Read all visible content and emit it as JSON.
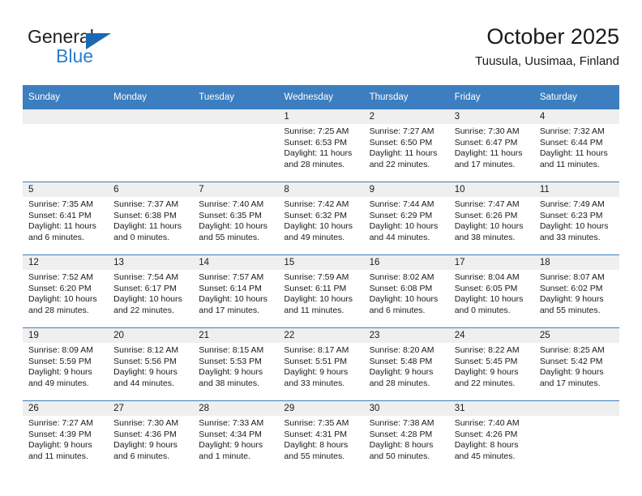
{
  "logo": {
    "word_top": "General",
    "word_bottom": "Blue",
    "triangle_color": "#1b68b3",
    "blue_color": "#2a7fc9"
  },
  "header": {
    "title": "October 2025",
    "location": "Tuusula, Uusimaa, Finland"
  },
  "theme": {
    "header_blue": "#3c7ebf",
    "daynum_band": "#efefef",
    "text": "#1a1a1a"
  },
  "calendar": {
    "weekdays": [
      "Sunday",
      "Monday",
      "Tuesday",
      "Wednesday",
      "Thursday",
      "Friday",
      "Saturday"
    ],
    "weeks": [
      [
        {
          "empty": true
        },
        {
          "empty": true
        },
        {
          "empty": true
        },
        {
          "day": "1",
          "sunrise": "Sunrise: 7:25 AM",
          "sunset": "Sunset: 6:53 PM",
          "daylight1": "Daylight: 11 hours",
          "daylight2": "and 28 minutes."
        },
        {
          "day": "2",
          "sunrise": "Sunrise: 7:27 AM",
          "sunset": "Sunset: 6:50 PM",
          "daylight1": "Daylight: 11 hours",
          "daylight2": "and 22 minutes."
        },
        {
          "day": "3",
          "sunrise": "Sunrise: 7:30 AM",
          "sunset": "Sunset: 6:47 PM",
          "daylight1": "Daylight: 11 hours",
          "daylight2": "and 17 minutes."
        },
        {
          "day": "4",
          "sunrise": "Sunrise: 7:32 AM",
          "sunset": "Sunset: 6:44 PM",
          "daylight1": "Daylight: 11 hours",
          "daylight2": "and 11 minutes."
        }
      ],
      [
        {
          "day": "5",
          "sunrise": "Sunrise: 7:35 AM",
          "sunset": "Sunset: 6:41 PM",
          "daylight1": "Daylight: 11 hours",
          "daylight2": "and 6 minutes."
        },
        {
          "day": "6",
          "sunrise": "Sunrise: 7:37 AM",
          "sunset": "Sunset: 6:38 PM",
          "daylight1": "Daylight: 11 hours",
          "daylight2": "and 0 minutes."
        },
        {
          "day": "7",
          "sunrise": "Sunrise: 7:40 AM",
          "sunset": "Sunset: 6:35 PM",
          "daylight1": "Daylight: 10 hours",
          "daylight2": "and 55 minutes."
        },
        {
          "day": "8",
          "sunrise": "Sunrise: 7:42 AM",
          "sunset": "Sunset: 6:32 PM",
          "daylight1": "Daylight: 10 hours",
          "daylight2": "and 49 minutes."
        },
        {
          "day": "9",
          "sunrise": "Sunrise: 7:44 AM",
          "sunset": "Sunset: 6:29 PM",
          "daylight1": "Daylight: 10 hours",
          "daylight2": "and 44 minutes."
        },
        {
          "day": "10",
          "sunrise": "Sunrise: 7:47 AM",
          "sunset": "Sunset: 6:26 PM",
          "daylight1": "Daylight: 10 hours",
          "daylight2": "and 38 minutes."
        },
        {
          "day": "11",
          "sunrise": "Sunrise: 7:49 AM",
          "sunset": "Sunset: 6:23 PM",
          "daylight1": "Daylight: 10 hours",
          "daylight2": "and 33 minutes."
        }
      ],
      [
        {
          "day": "12",
          "sunrise": "Sunrise: 7:52 AM",
          "sunset": "Sunset: 6:20 PM",
          "daylight1": "Daylight: 10 hours",
          "daylight2": "and 28 minutes."
        },
        {
          "day": "13",
          "sunrise": "Sunrise: 7:54 AM",
          "sunset": "Sunset: 6:17 PM",
          "daylight1": "Daylight: 10 hours",
          "daylight2": "and 22 minutes."
        },
        {
          "day": "14",
          "sunrise": "Sunrise: 7:57 AM",
          "sunset": "Sunset: 6:14 PM",
          "daylight1": "Daylight: 10 hours",
          "daylight2": "and 17 minutes."
        },
        {
          "day": "15",
          "sunrise": "Sunrise: 7:59 AM",
          "sunset": "Sunset: 6:11 PM",
          "daylight1": "Daylight: 10 hours",
          "daylight2": "and 11 minutes."
        },
        {
          "day": "16",
          "sunrise": "Sunrise: 8:02 AM",
          "sunset": "Sunset: 6:08 PM",
          "daylight1": "Daylight: 10 hours",
          "daylight2": "and 6 minutes."
        },
        {
          "day": "17",
          "sunrise": "Sunrise: 8:04 AM",
          "sunset": "Sunset: 6:05 PM",
          "daylight1": "Daylight: 10 hours",
          "daylight2": "and 0 minutes."
        },
        {
          "day": "18",
          "sunrise": "Sunrise: 8:07 AM",
          "sunset": "Sunset: 6:02 PM",
          "daylight1": "Daylight: 9 hours",
          "daylight2": "and 55 minutes."
        }
      ],
      [
        {
          "day": "19",
          "sunrise": "Sunrise: 8:09 AM",
          "sunset": "Sunset: 5:59 PM",
          "daylight1": "Daylight: 9 hours",
          "daylight2": "and 49 minutes."
        },
        {
          "day": "20",
          "sunrise": "Sunrise: 8:12 AM",
          "sunset": "Sunset: 5:56 PM",
          "daylight1": "Daylight: 9 hours",
          "daylight2": "and 44 minutes."
        },
        {
          "day": "21",
          "sunrise": "Sunrise: 8:15 AM",
          "sunset": "Sunset: 5:53 PM",
          "daylight1": "Daylight: 9 hours",
          "daylight2": "and 38 minutes."
        },
        {
          "day": "22",
          "sunrise": "Sunrise: 8:17 AM",
          "sunset": "Sunset: 5:51 PM",
          "daylight1": "Daylight: 9 hours",
          "daylight2": "and 33 minutes."
        },
        {
          "day": "23",
          "sunrise": "Sunrise: 8:20 AM",
          "sunset": "Sunset: 5:48 PM",
          "daylight1": "Daylight: 9 hours",
          "daylight2": "and 28 minutes."
        },
        {
          "day": "24",
          "sunrise": "Sunrise: 8:22 AM",
          "sunset": "Sunset: 5:45 PM",
          "daylight1": "Daylight: 9 hours",
          "daylight2": "and 22 minutes."
        },
        {
          "day": "25",
          "sunrise": "Sunrise: 8:25 AM",
          "sunset": "Sunset: 5:42 PM",
          "daylight1": "Daylight: 9 hours",
          "daylight2": "and 17 minutes."
        }
      ],
      [
        {
          "day": "26",
          "sunrise": "Sunrise: 7:27 AM",
          "sunset": "Sunset: 4:39 PM",
          "daylight1": "Daylight: 9 hours",
          "daylight2": "and 11 minutes."
        },
        {
          "day": "27",
          "sunrise": "Sunrise: 7:30 AM",
          "sunset": "Sunset: 4:36 PM",
          "daylight1": "Daylight: 9 hours",
          "daylight2": "and 6 minutes."
        },
        {
          "day": "28",
          "sunrise": "Sunrise: 7:33 AM",
          "sunset": "Sunset: 4:34 PM",
          "daylight1": "Daylight: 9 hours",
          "daylight2": "and 1 minute."
        },
        {
          "day": "29",
          "sunrise": "Sunrise: 7:35 AM",
          "sunset": "Sunset: 4:31 PM",
          "daylight1": "Daylight: 8 hours",
          "daylight2": "and 55 minutes."
        },
        {
          "day": "30",
          "sunrise": "Sunrise: 7:38 AM",
          "sunset": "Sunset: 4:28 PM",
          "daylight1": "Daylight: 8 hours",
          "daylight2": "and 50 minutes."
        },
        {
          "day": "31",
          "sunrise": "Sunrise: 7:40 AM",
          "sunset": "Sunset: 4:26 PM",
          "daylight1": "Daylight: 8 hours",
          "daylight2": "and 45 minutes."
        },
        {
          "empty": true
        }
      ]
    ]
  }
}
